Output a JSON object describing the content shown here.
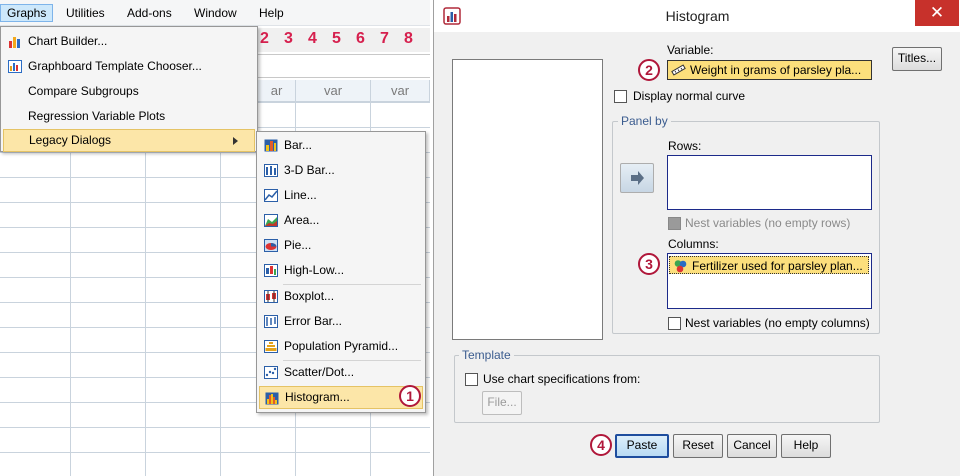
{
  "menubar": {
    "items": [
      "Graphs",
      "Utilities",
      "Add-ons",
      "Window",
      "Help"
    ]
  },
  "column_numbers": [
    "2",
    "3",
    "4",
    "5",
    "6",
    "7",
    "8"
  ],
  "grid_headers": [
    "ar",
    "var",
    "var"
  ],
  "graphs_menu": {
    "items": [
      {
        "label": "Chart Builder...",
        "icon": "chart-builder-icon"
      },
      {
        "label": "Graphboard Template Chooser...",
        "icon": "graphboard-icon"
      },
      {
        "label": "Compare Subgroups"
      },
      {
        "label": "Regression Variable Plots"
      },
      {
        "label": "Legacy Dialogs",
        "submenu": true
      }
    ]
  },
  "legacy_menu": {
    "items": [
      {
        "label": "Bar...",
        "icon": "bar-chart-icon"
      },
      {
        "label": "3-D Bar...",
        "icon": "3d-bar-icon"
      },
      {
        "label": "Line...",
        "icon": "line-chart-icon"
      },
      {
        "label": "Area...",
        "icon": "area-chart-icon"
      },
      {
        "label": "Pie...",
        "icon": "pie-chart-icon"
      },
      {
        "label": "High-Low...",
        "icon": "high-low-icon"
      },
      {
        "label": "Boxplot...",
        "icon": "boxplot-icon"
      },
      {
        "label": "Error Bar...",
        "icon": "error-bar-icon"
      },
      {
        "label": "Population Pyramid...",
        "icon": "population-pyramid-icon"
      },
      {
        "label": "Scatter/Dot...",
        "icon": "scatter-icon"
      },
      {
        "label": "Histogram...",
        "icon": "histogram-icon"
      }
    ]
  },
  "callouts": [
    "1",
    "2",
    "3",
    "4"
  ],
  "dialog": {
    "title": "Histogram",
    "close_symbol": "✕",
    "variable_label": "Variable:",
    "variable_value": "Weight in grams of parsley pla...",
    "titles_button": "Titles...",
    "display_normal_curve": "Display normal curve",
    "panel_by": "Panel by",
    "rows_label": "Rows:",
    "nest_rows": "Nest variables (no empty rows)",
    "columns_label": "Columns:",
    "columns_value": "Fertilizer used for parsley plan...",
    "nest_columns": "Nest variables (no empty columns)",
    "template": "Template",
    "use_chart_spec": "Use chart specifications from:",
    "file_button": "File...",
    "buttons": {
      "paste": "Paste",
      "reset": "Reset",
      "cancel": "Cancel",
      "help": "Help"
    }
  },
  "colors": {
    "accent_red": "#d6204e",
    "highlight": "#fce6a8",
    "selected_field": "#fcdf7c",
    "close_button": "#c7312b"
  }
}
